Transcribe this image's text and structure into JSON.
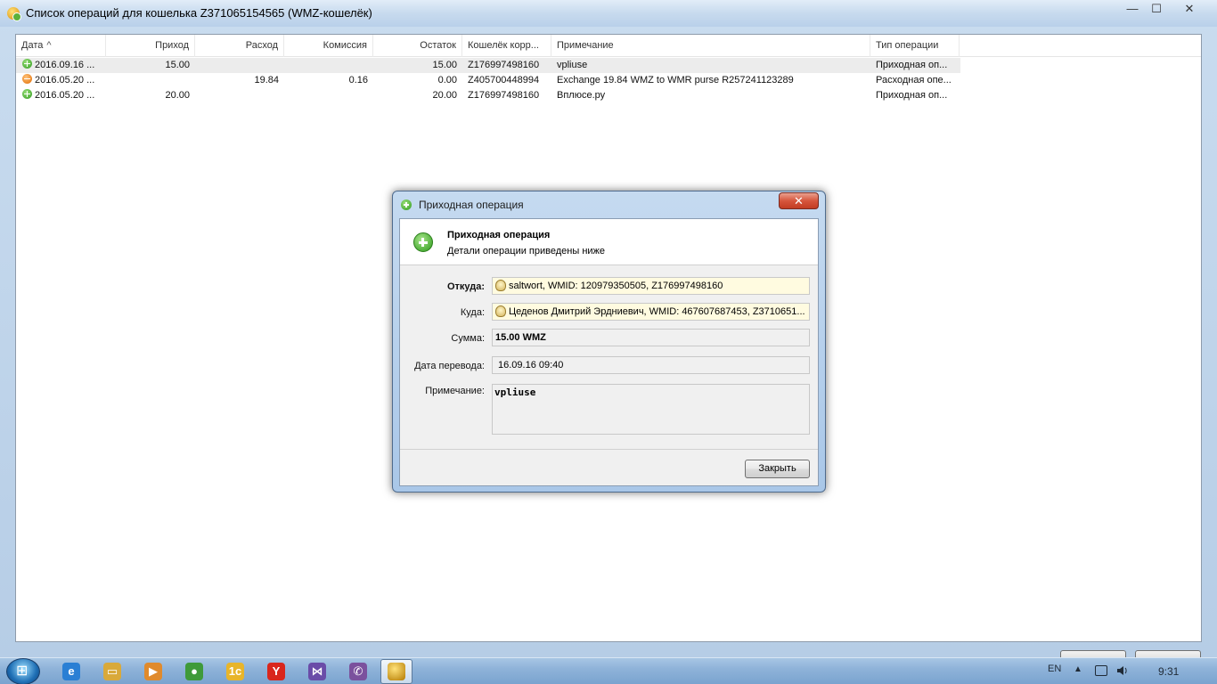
{
  "window": {
    "title": "Список операций для кошелька Z371065154565 (WMZ-кошелёк)",
    "minimize": "—",
    "maximize": "☐",
    "close": "✕"
  },
  "table": {
    "columns": [
      "Дата",
      "Приход",
      "Расход",
      "Комиссия",
      "Остаток",
      "Кошелёк корр...",
      "Примечание",
      "Тип операции"
    ],
    "sort_indicator": "^",
    "rows": [
      {
        "date": "2016.09.16 ...",
        "income": "15.00",
        "expense": "",
        "fee": "",
        "balance": "15.00",
        "purse": "Z176997498160",
        "note": "vpliuse",
        "type": "Приходная оп...",
        "kind": "plus",
        "selected": true
      },
      {
        "date": "2016.05.20 ...",
        "income": "",
        "expense": "19.84",
        "fee": "0.16",
        "balance": "0.00",
        "purse": "Z405700448994",
        "note": "Exchange 19.84 WMZ to WMR purse R257241123289",
        "type": "Расходная опе...",
        "kind": "minus",
        "selected": false
      },
      {
        "date": "2016.05.20 ...",
        "income": "20.00",
        "expense": "",
        "fee": "",
        "balance": "20.00",
        "purse": "Z176997498160",
        "note": "Вплюсе.ру",
        "type": "Приходная оп...",
        "kind": "plus",
        "selected": false
      }
    ]
  },
  "dialog": {
    "title": "Приходная операция",
    "close_glyph": "✕",
    "header_title": "Приходная операция",
    "header_subtitle": "Детали операции приведены ниже",
    "from_label": "Откуда:",
    "from_value": "saltwort, WMID: 120979350505, Z176997498160",
    "to_label": "Куда:",
    "to_value": "Цеденов Дмитрий Эрдниевич, WMID: 467607687453, Z3710651...",
    "amount_label": "Сумма:",
    "amount_value": "15.00 WMZ",
    "date_label": "Дата перевода:",
    "date_value": "16.09.16 09:40",
    "note_label": "Примечание:",
    "note_value": "vpliuse",
    "close_button": "Закрыть"
  },
  "taskbar": {
    "icons": [
      {
        "name": "internet-explorer-icon",
        "glyph": "e",
        "color": "#2a7fd4"
      },
      {
        "name": "file-explorer-icon",
        "glyph": "▭",
        "color": "#d9a93a"
      },
      {
        "name": "media-player-icon",
        "glyph": "▶",
        "color": "#e08a2c"
      },
      {
        "name": "chrome-icon",
        "glyph": "●",
        "color": "#3f9a3a"
      },
      {
        "name": "1c-icon",
        "glyph": "1c",
        "color": "#e8b52a"
      },
      {
        "name": "yandex-browser-icon",
        "glyph": "Y",
        "color": "#d9261c"
      },
      {
        "name": "visual-studio-icon",
        "glyph": "⋈",
        "color": "#6a4ca8"
      },
      {
        "name": "viber-icon",
        "glyph": "✆",
        "color": "#7b519d"
      }
    ],
    "language": "EN",
    "tray_up": "▲",
    "clock": "9:31"
  }
}
